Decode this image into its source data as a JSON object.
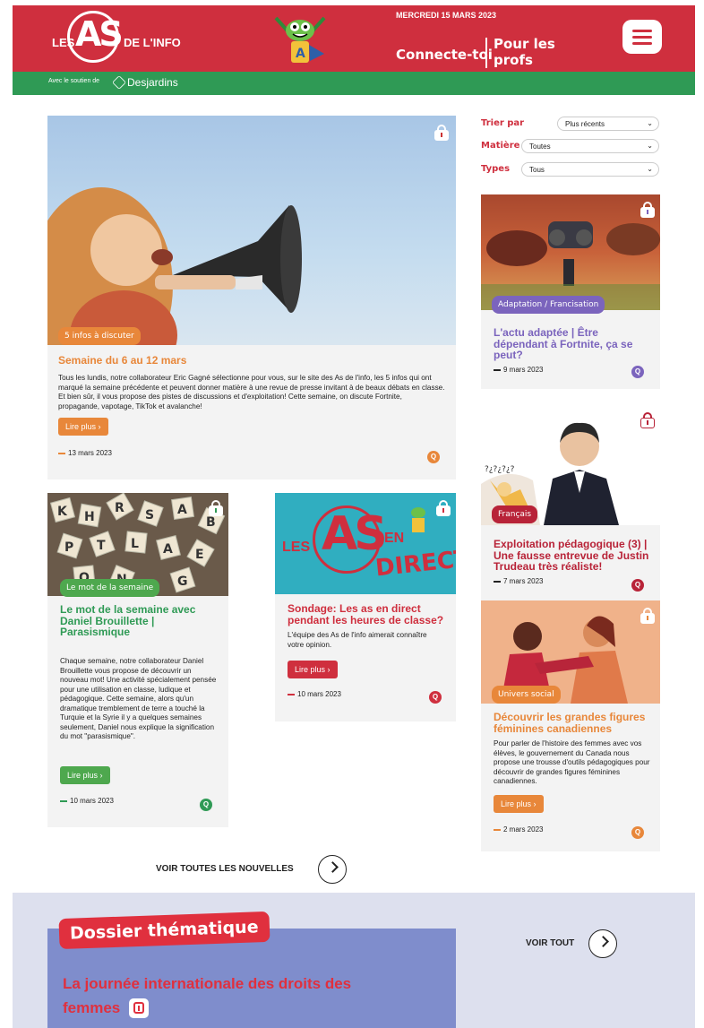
{
  "header": {
    "logo_les": "LES",
    "logo_as": "AS",
    "logo_de": "DE L'INFO",
    "date": "MERCREDI 15 MARS 2023",
    "connect": "Connecte-toi",
    "profs_line1": "Pour les",
    "profs_line2": "profs",
    "menu_icon": "hamburger-icon"
  },
  "support": {
    "text": "Avec le soutien de",
    "brand": "Desjardins"
  },
  "filters": {
    "sort_label": "Trier par",
    "sort_value": "Plus récents",
    "subject_label": "Matière",
    "subject_value": "Toutes",
    "types_label": "Types",
    "types_value": "Tous"
  },
  "main_card": {
    "tag": "5 infos à discuter",
    "title": "Semaine du 6 au 12 mars",
    "desc": "Tous les lundis, notre collaborateur Eric Gagné sélectionne pour vous, sur le site des As de l'info, les 5 infos qui ont marqué la semaine précédente et peuvent donner matière à une revue de presse invitant à de beaux débats en classe. Et bien sûr, il vous propose des pistes de discussions et d'exploitation! Cette semaine, on discute Fortnite, propagande, vapotage, TikTok et avalanche!",
    "button": "Lire plus",
    "date": "13 mars 2023"
  },
  "fortnite_card": {
    "tag": "Adaptation / Francisation",
    "title": "L'actu adaptée | Être dépendant à Fortnite, ça se peut?",
    "date": "9 mars 2023"
  },
  "trudeau_card": {
    "tag": "Français",
    "title": "Exploitation pédagogique (3) | Une fausse entrevue de Justin Trudeau très réaliste!",
    "date": "7 mars 2023"
  },
  "mot_card": {
    "tag": "Le mot de la semaine",
    "title": "Le mot de la semaine avec Daniel Brouillette | Parasismique",
    "desc": "Chaque semaine, notre collaborateur Daniel Brouillette vous propose de découvrir un nouveau mot! Une activité spécialement pensée pour une utilisation en classe, ludique et pédagogique. Cette semaine, alors qu'un dramatique tremblement de terre a touché la Turquie et la Syrie il y a quelques semaines seulement, Daniel nous explique la signification du mot \"parasismique\".",
    "button": "Lire plus",
    "date": "10 mars 2023"
  },
  "sondage_card": {
    "img_les": "LES",
    "img_as": "AS",
    "img_en": "EN",
    "img_direct": "DIRECT",
    "title": "Sondage: Les as en direct pendant les heures de classe?",
    "desc": "L'équipe des As de l'info aimerait connaître votre opinion.",
    "button": "Lire plus",
    "date": "10 mars 2023"
  },
  "femmes_card": {
    "tag": "Univers social",
    "title": "Découvrir les grandes figures féminines canadiennes",
    "desc": "Pour parler de l'histoire des femmes avec vos élèves, le gouvernement du Canada nous propose une trousse d'outils pédagogiques pour découvrir de grandes figures féminines canadiennes.",
    "button": "Lire plus",
    "date": "2 mars 2023"
  },
  "voir_toutes": "VOIR TOUTES LES NOUVELLES",
  "dossier": {
    "tag": "Dossier thématique",
    "voir_tout": "VOIR TOUT",
    "title_line1": "La journée internationale des droits des",
    "title_line2": "femmes"
  },
  "q_badge": "Q",
  "colors": {
    "red": "#cf2f3e",
    "green": "#2f9a55",
    "orange": "#e8873a",
    "purple": "#7b64bd",
    "burgundy": "#b82338",
    "lightbg": "#f3f3f3",
    "dossier_bg": "#dde0ee"
  }
}
